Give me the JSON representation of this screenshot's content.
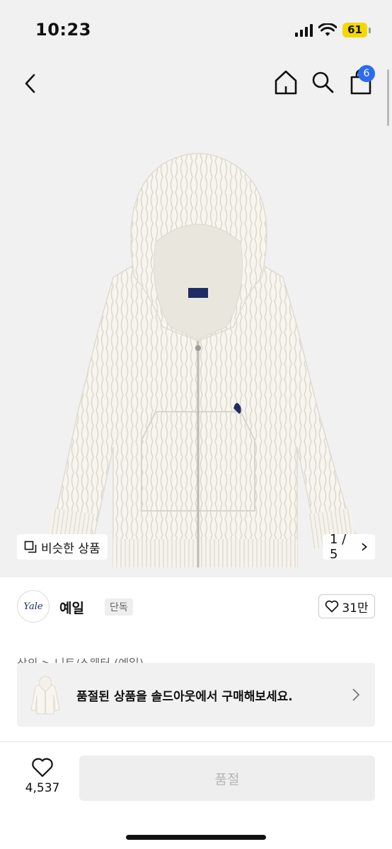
{
  "status_bar": {
    "time": "10:23",
    "battery": "61"
  },
  "nav": {
    "cart_count": "6"
  },
  "image": {
    "similar_label": "비슷한 상품",
    "page_indicator": "1 / 5"
  },
  "brand": {
    "logo_text": "Yale",
    "name": "예일",
    "tag": "단독",
    "like_count": "31만"
  },
  "breadcrumb": "상의 > 니트/스웨터 (예일)",
  "soldout_banner": {
    "text": "품절된 상품을 솔드아웃에서 구매해보세요."
  },
  "bottom_bar": {
    "wish_count": "4,537",
    "main_button": "품절"
  },
  "colors": {
    "accent_blue": "#2a6cf0",
    "background_gray": "#f1f1f1",
    "disabled_text": "#b5b5b5",
    "battery_yellow": "#f5d800"
  }
}
